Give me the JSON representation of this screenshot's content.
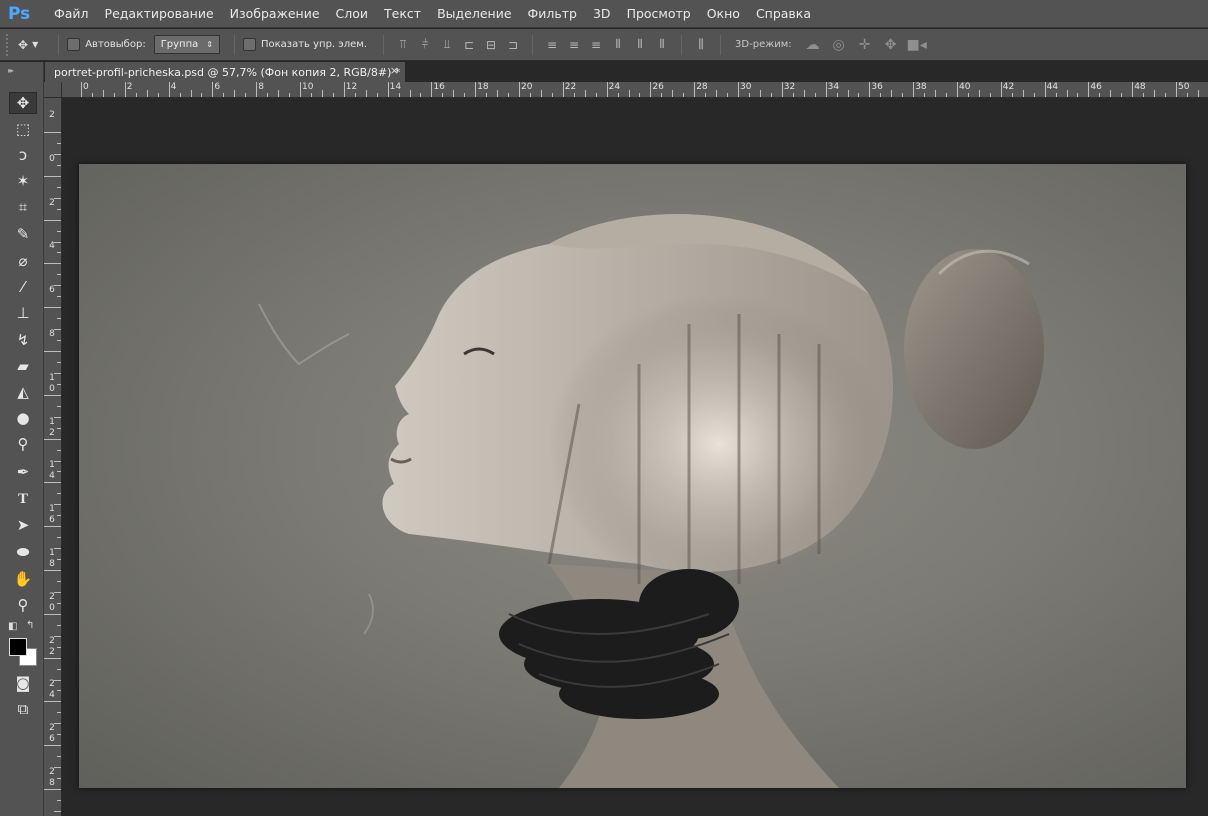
{
  "app": {
    "logo": "Ps"
  },
  "menu": [
    "Файл",
    "Редактирование",
    "Изображение",
    "Слои",
    "Текст",
    "Выделение",
    "Фильтр",
    "3D",
    "Просмотр",
    "Окно",
    "Справка"
  ],
  "options": {
    "auto_select_label": "Автовыбор:",
    "auto_select_value": "Группа",
    "show_transform_label": "Показать упр. элем.",
    "threed_mode_label": "3D-режим:"
  },
  "document_tab": {
    "title": "portret-profil-pricheska.psd @ 57,7% (Фон копия 2, RGB/8#) *",
    "close": "×"
  },
  "ruler_top": [
    "0",
    "2",
    "4",
    "6",
    "8",
    "10",
    "12",
    "14",
    "16",
    "18",
    "20",
    "22",
    "24",
    "26",
    "28",
    "30",
    "32",
    "34",
    "36",
    "38",
    "40",
    "42",
    "44",
    "46",
    "48",
    "50"
  ],
  "ruler_left": [
    "2",
    "0",
    "2",
    "4",
    "6",
    "8",
    "1 0",
    "1 2",
    "1 4",
    "1 6",
    "1 8",
    "2 0",
    "2 2",
    "2 4",
    "2 6",
    "2 8"
  ],
  "tools": [
    {
      "name": "move-tool",
      "icon": "move-icon",
      "glyph": "✥"
    },
    {
      "name": "marquee-tool",
      "icon": "rect-marquee-icon",
      "glyph": "⬚"
    },
    {
      "name": "lasso-tool",
      "icon": "lasso-icon",
      "glyph": "ↄ"
    },
    {
      "name": "magic-wand-tool",
      "icon": "magic-wand-icon",
      "glyph": "✶"
    },
    {
      "name": "crop-tool",
      "icon": "crop-icon",
      "glyph": "⌗"
    },
    {
      "name": "eyedropper-tool",
      "icon": "eyedropper-icon",
      "glyph": "✎"
    },
    {
      "name": "healing-tool",
      "icon": "healing-brush-icon",
      "glyph": "⌀"
    },
    {
      "name": "brush-tool",
      "icon": "brush-icon",
      "glyph": "⁄"
    },
    {
      "name": "stamp-tool",
      "icon": "clone-stamp-icon",
      "glyph": "⊥"
    },
    {
      "name": "history-brush-tool",
      "icon": "history-brush-icon",
      "glyph": "↯"
    },
    {
      "name": "eraser-tool",
      "icon": "eraser-icon",
      "glyph": "▰"
    },
    {
      "name": "paint-bucket-tool",
      "icon": "paint-bucket-icon",
      "glyph": "◭"
    },
    {
      "name": "blur-tool",
      "icon": "blur-drop-icon",
      "glyph": "●"
    },
    {
      "name": "dodge-tool",
      "icon": "dodge-icon",
      "glyph": "⚲"
    },
    {
      "name": "pen-tool",
      "icon": "pen-icon",
      "glyph": "✒"
    },
    {
      "name": "type-tool",
      "icon": "type-icon",
      "glyph": "T"
    },
    {
      "name": "path-selection-tool",
      "icon": "path-select-icon",
      "glyph": "➤"
    },
    {
      "name": "ellipse-tool",
      "icon": "ellipse-icon",
      "glyph": "⬬"
    },
    {
      "name": "hand-tool",
      "icon": "hand-icon",
      "glyph": "✋"
    },
    {
      "name": "zoom-tool",
      "icon": "zoom-icon",
      "glyph": "⚲"
    }
  ],
  "colors": {
    "panel": "#535353",
    "workspace": "#282828",
    "accent": "#4fa8ff"
  }
}
